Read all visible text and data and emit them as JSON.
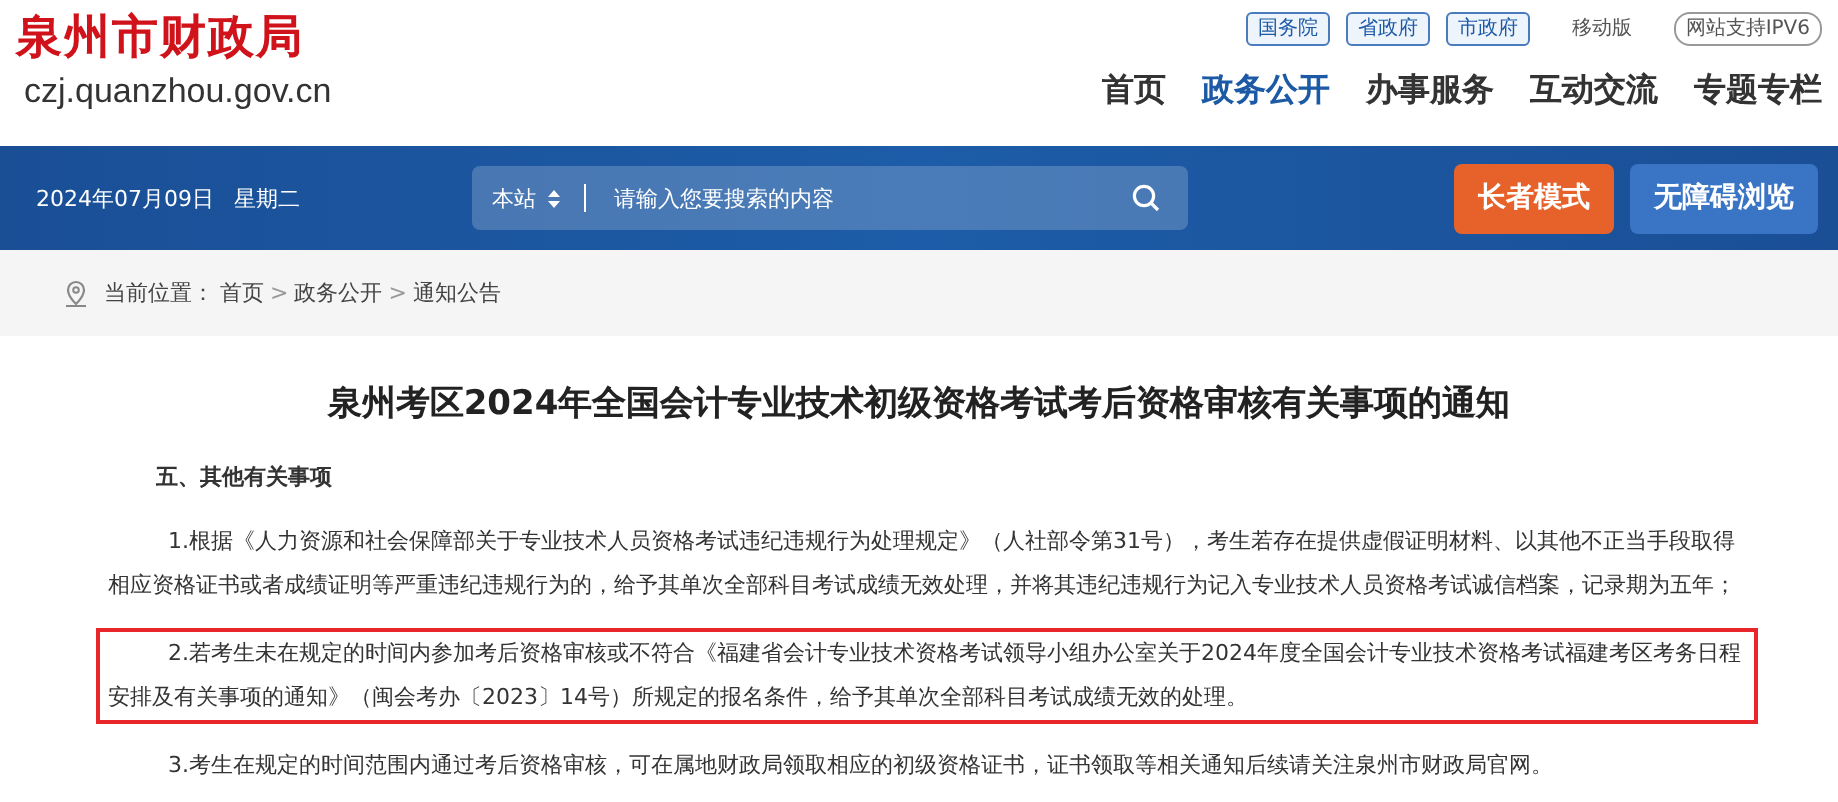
{
  "site": {
    "name": "泉州市财政局",
    "domain": "czj.quanzhou.gov.cn"
  },
  "top_links": [
    {
      "label": "国务院",
      "kind": "tag"
    },
    {
      "label": "省政府",
      "kind": "tag"
    },
    {
      "label": "市政府",
      "kind": "tag"
    },
    {
      "label": "移动版",
      "kind": "plain"
    },
    {
      "label": "网站支持IPV6",
      "kind": "pill"
    }
  ],
  "nav": [
    {
      "label": "首页",
      "selected": false
    },
    {
      "label": "政务公开",
      "selected": true
    },
    {
      "label": "办事服务",
      "selected": false
    },
    {
      "label": "互动交流",
      "selected": false
    },
    {
      "label": "专题专栏",
      "selected": false
    }
  ],
  "banner": {
    "date": "2024年07月09日",
    "weekday": "星期二",
    "scope": "本站",
    "placeholder": "请输入您要搜索的内容",
    "buttons": [
      {
        "label": "长者模式",
        "kind": "orange"
      },
      {
        "label": "无障碍浏览",
        "kind": "blue"
      }
    ]
  },
  "breadcrumb": {
    "label": "当前位置：",
    "separator": ">",
    "items": [
      "首页",
      "政务公开",
      "通知公告"
    ]
  },
  "article": {
    "title": "泉州考区2024年全国会计专业技术初级资格考试考后资格审核有关事项的通知",
    "section": "五、其他有关事项",
    "paragraphs": [
      {
        "text": "1.根据《人力资源和社会保障部关于专业技术人员资格考试违纪违规行为处理规定》（人社部令第31号），考生若存在提供虚假证明材料、以其他不正当手段取得相应资格证书或者成绩证明等严重违纪违规行为的，给予其单次全部科目考试成绩无效处理，并将其违纪违规行为记入专业技术人员资格考试诚信档案，记录期为五年；",
        "highlighted": false
      },
      {
        "text": "2.若考生未在规定的时间内参加考后资格审核或不符合《福建省会计专业技术资格考试领导小组办公室关于2024年度全国会计专业技术资格考试福建考区考务日程安排及有关事项的通知》（闽会考办〔2023〕14号）所规定的报名条件，给予其单次全部科目考试成绩无效的处理。",
        "highlighted": true
      },
      {
        "text": "3.考生在规定的时间范围内通过考后资格审核，可在属地财政局领取相应的初级资格证书，证书领取等相关通知后续请关注泉州市财政局官网。",
        "highlighted": false
      }
    ]
  }
}
